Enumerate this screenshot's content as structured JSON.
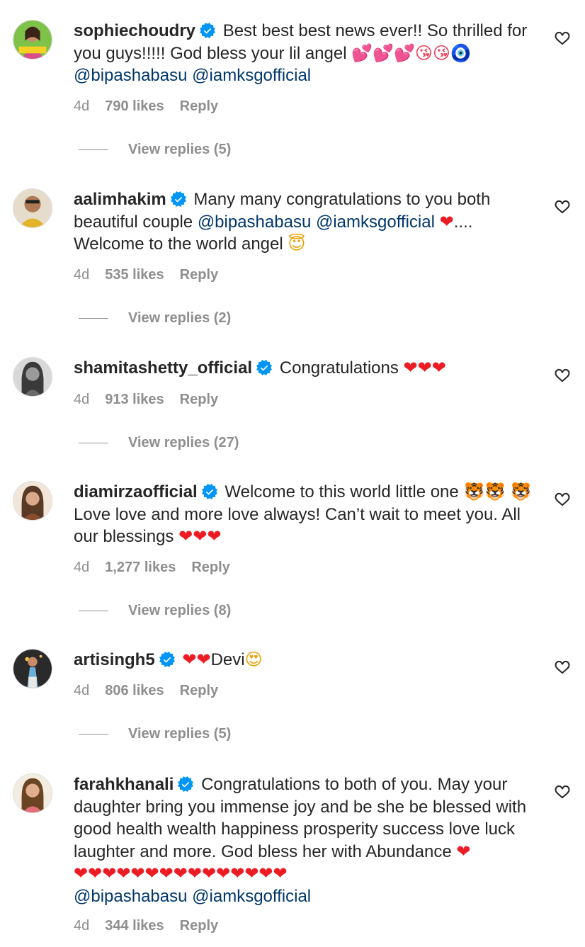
{
  "comments": [
    {
      "username": "sophiechoudry",
      "text": "Best best best news ever!! So thrilled for you guys!!!!! God bless your lil angel",
      "emojis": "💕💕💕😘😘🧿",
      "mention1": "@bipashabasu",
      "mention2": "@iamksgofficial",
      "time": "4d",
      "likes": "790 likes",
      "reply": "Reply",
      "view_replies": "View replies (5)"
    },
    {
      "username": "aalimhakim",
      "text1": "Many many congratulations to you both beautiful couple",
      "mention1": "@bipashabasu",
      "mention2": "@iamksgofficial",
      "heart": "❤",
      "after": "....",
      "text2": "Welcome to the world angel",
      "emoji2": "😇",
      "time": "4d",
      "likes": "535 likes",
      "reply": "Reply",
      "view_replies": "View replies (2)"
    },
    {
      "username": "shamitashetty_official",
      "text": "Congratulations",
      "hearts": "❤❤❤",
      "time": "4d",
      "likes": "913 likes",
      "reply": "Reply",
      "view_replies": "View replies (27)"
    },
    {
      "username": "diamirzaofficial",
      "text1": "Welcome to this world little one",
      "tigers": "🐯🐯",
      "tiger2": "🐯",
      "text2": "Love love and more love always! Can’t wait to meet you. All our blessings",
      "hearts": "❤❤❤",
      "time": "4d",
      "likes": "1,277 likes",
      "reply": "Reply",
      "view_replies": "View replies (8)"
    },
    {
      "username": "artisingh5",
      "hearts": "❤❤",
      "text": "Devi",
      "emoji": "😍",
      "time": "4d",
      "likes": "806 likes",
      "reply": "Reply",
      "view_replies": "View replies (5)"
    },
    {
      "username": "farahkhanali",
      "text": "Congratulations to both of you. May your daughter bring you immense joy and be she be blessed with good health wealth happiness prosperity success love luck laughter and more. God bless her with Abundance",
      "heart": "❤",
      "hearts": "❤❤❤❤❤❤❤❤❤❤❤❤❤❤❤",
      "mention1": "@bipashabasu",
      "mention2": "@iamksgofficial",
      "time": "4d",
      "likes": "344 likes",
      "reply": "Reply"
    }
  ],
  "colors": {
    "mention": "#00376b",
    "meta": "#8e8e8e",
    "verified": "#0095f6",
    "text": "#262626"
  },
  "icons": [
    "verified-badge-icon",
    "heart-outline-icon",
    "avatar"
  ]
}
